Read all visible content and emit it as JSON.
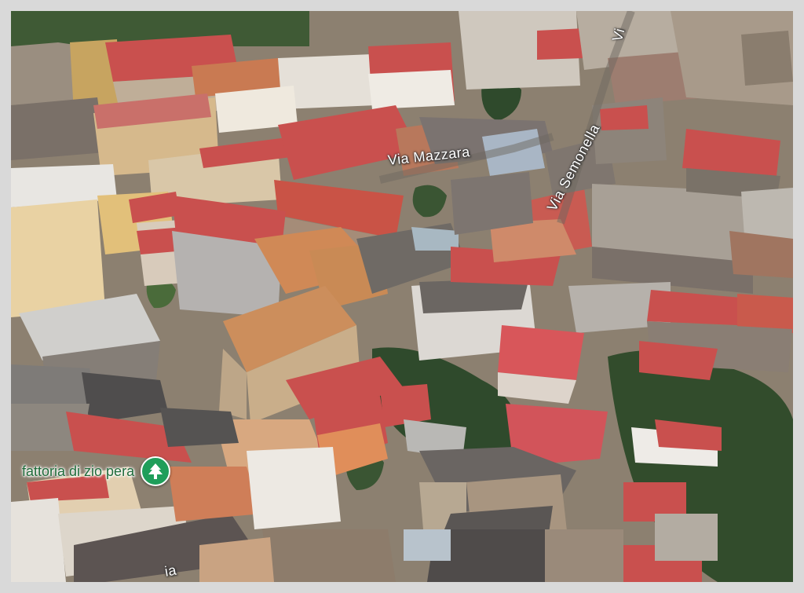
{
  "map": {
    "streets": [
      {
        "name": "Via Mazzara"
      },
      {
        "name": "Via Semonella"
      },
      {
        "name": "Vi"
      },
      {
        "name": "ia"
      }
    ],
    "poi": {
      "name": "fattoria di zio pera",
      "icon": "tree-icon",
      "color": "#1f9e5a"
    }
  }
}
